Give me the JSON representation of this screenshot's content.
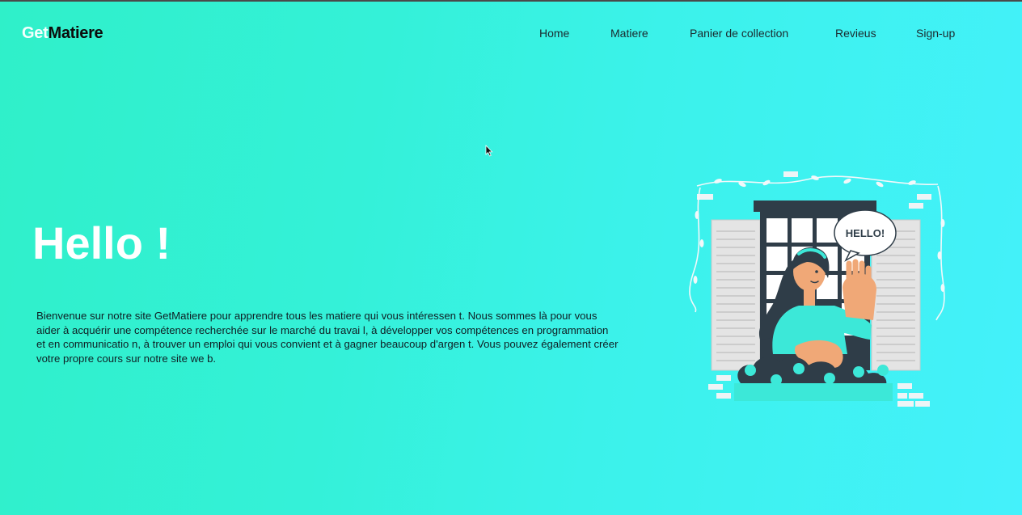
{
  "navbar": {
    "logo_part1": "Get",
    "logo_part2": "Matiere",
    "items": [
      {
        "label": "Home"
      },
      {
        "label": "Matiere"
      },
      {
        "label": "Panier de collection"
      },
      {
        "label": "Revieus"
      },
      {
        "label": "Sign-up"
      }
    ]
  },
  "hero": {
    "title": "Hello  !",
    "text": "Bienvenue sur notre site GetMatiere pour apprendre tous les matiere qui vous intéressen t. Nous sommes là pour vous aider à acquérir une compétence recherchée sur le marché du travai l, à développer vos compétences en programmation et en communicatio n, à trouver un emploi qui vous convient et à gagner beaucoup d'argen t. Vous pouvez également créer votre propre cours sur notre site we b."
  },
  "illustration": {
    "speech_bubble": "HELLO!"
  },
  "colors": {
    "bg_start": "#2ff0c9",
    "bg_end": "#44f1fb",
    "accent_teal": "#3ce8d8",
    "dark_navy": "#2f3d48"
  }
}
